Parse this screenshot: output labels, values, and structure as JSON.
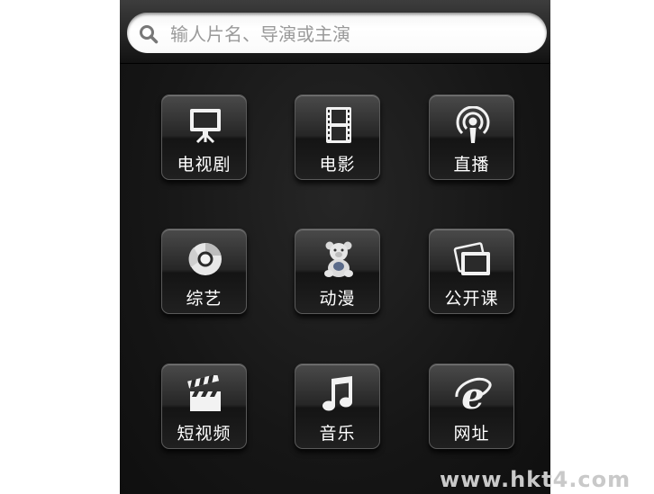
{
  "search": {
    "placeholder": "输人片名、导演或主演"
  },
  "categories": [
    {
      "label": "电视剧",
      "icon": "tv-icon"
    },
    {
      "label": "电影",
      "icon": "film-icon"
    },
    {
      "label": "直播",
      "icon": "broadcast-icon"
    },
    {
      "label": "综艺",
      "icon": "variety-icon"
    },
    {
      "label": "动漫",
      "icon": "teddy-bear-icon"
    },
    {
      "label": "公开课",
      "icon": "photos-icon"
    },
    {
      "label": "短视频",
      "icon": "clapperboard-icon"
    },
    {
      "label": "音乐",
      "icon": "music-note-icon"
    },
    {
      "label": "网址",
      "icon": "browser-icon"
    }
  ],
  "watermark": "www.hkt4.com"
}
